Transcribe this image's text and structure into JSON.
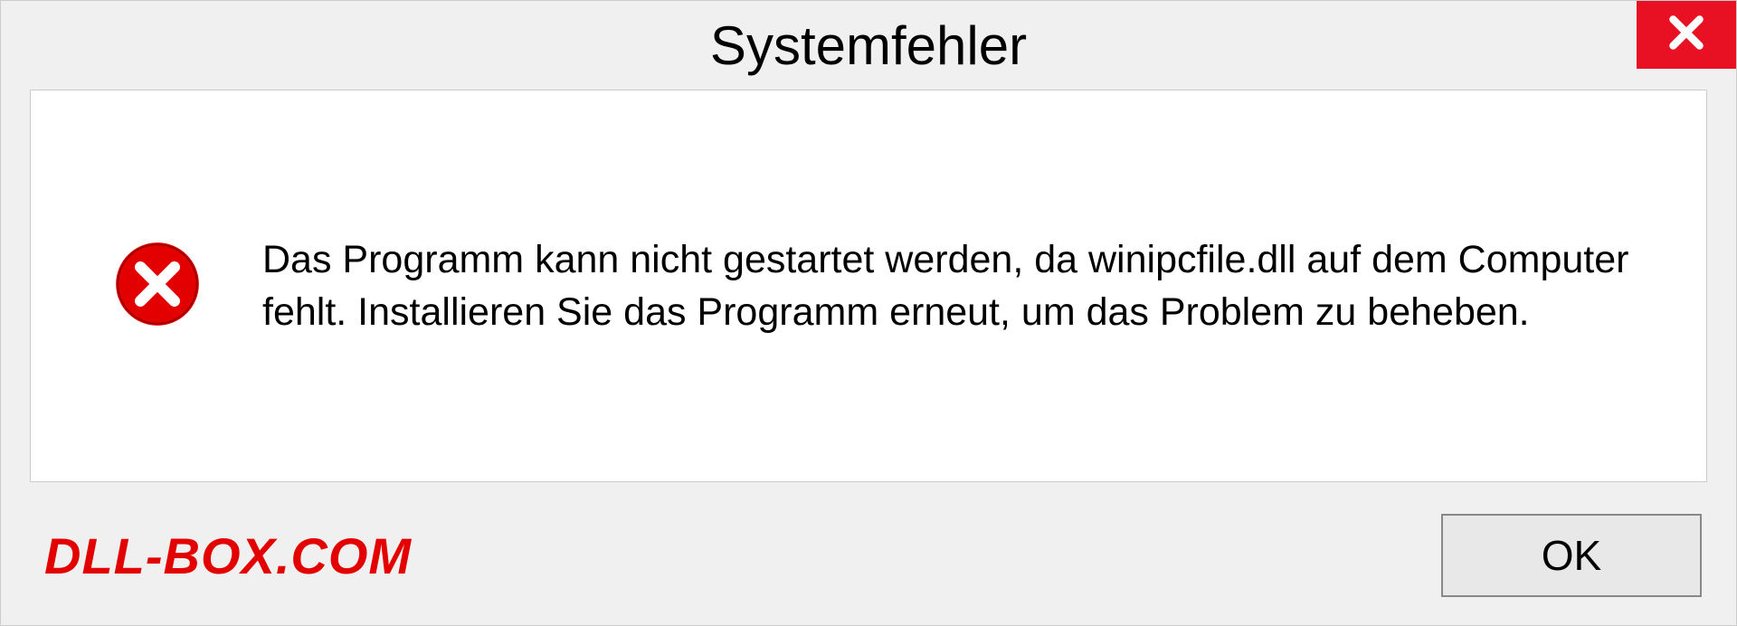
{
  "dialog": {
    "title": "Systemfehler",
    "message": "Das Programm kann nicht gestartet werden, da winipcfile.dll auf dem Computer fehlt. Installieren Sie das Programm erneut, um das Problem zu beheben.",
    "ok_label": "OK"
  },
  "watermark": "DLL-BOX.COM",
  "colors": {
    "close_bg": "#e81123",
    "error_icon": "#e30000",
    "watermark": "#e30000"
  }
}
